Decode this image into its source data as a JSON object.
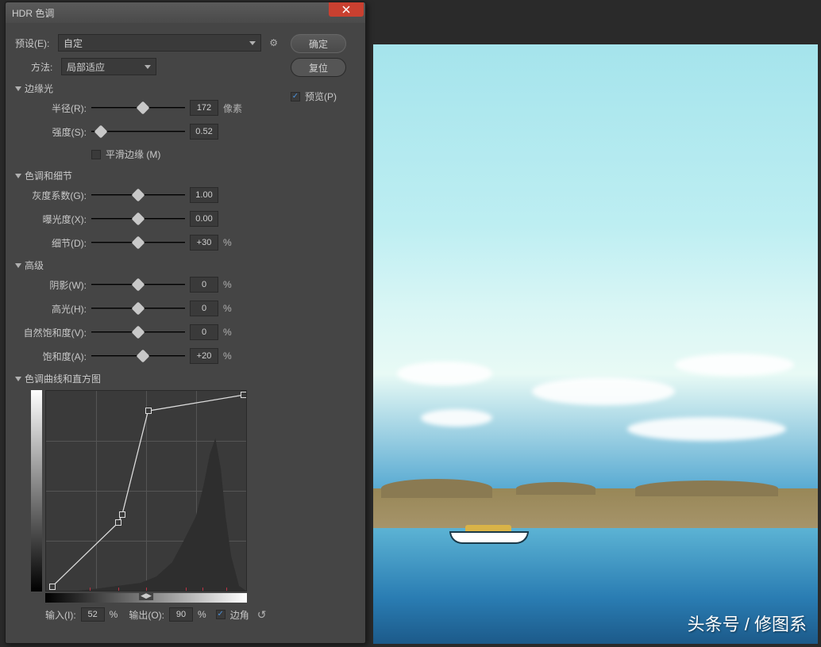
{
  "dialog": {
    "title": "HDR 色调",
    "preset_label": "预设(E):",
    "preset_value": "自定",
    "method_label": "方法:",
    "method_value": "局部适应"
  },
  "buttons": {
    "ok": "确定",
    "reset": "复位"
  },
  "preview": {
    "label": "预览(P)",
    "checked": true
  },
  "sections": {
    "edge": "边缘光",
    "tone": "色调和细节",
    "advanced": "高级",
    "curve": "色调曲线和直方图"
  },
  "sliders": {
    "radius": {
      "label": "半径(R):",
      "value": "172",
      "unit": "像素",
      "pos": 55
    },
    "strength": {
      "label": "强度(S):",
      "value": "0.52",
      "unit": "",
      "pos": 10
    },
    "smooth": {
      "label": "平滑边缘 (M)",
      "checked": false
    },
    "gamma": {
      "label": "灰度系数(G):",
      "value": "1.00",
      "unit": "",
      "pos": 50
    },
    "exposure": {
      "label": "曝光度(X):",
      "value": "0.00",
      "unit": "",
      "pos": 50
    },
    "detail": {
      "label": "细节(D):",
      "value": "+30",
      "unit": "%",
      "pos": 50
    },
    "shadow": {
      "label": "阴影(W):",
      "value": "0",
      "unit": "%",
      "pos": 50
    },
    "highlight": {
      "label": "高光(H):",
      "value": "0",
      "unit": "%",
      "pos": 50
    },
    "vibrance": {
      "label": "自然饱和度(V):",
      "value": "0",
      "unit": "%",
      "pos": 50
    },
    "saturation": {
      "label": "饱和度(A):",
      "value": "+20",
      "unit": "%",
      "pos": 55
    }
  },
  "curve": {
    "input_label": "输入(I):",
    "input_value": "52",
    "input_unit": "%",
    "output_label": "输出(O):",
    "output_value": "90",
    "output_unit": "%",
    "corner_label": "边角",
    "points": [
      {
        "x": 3,
        "y": 98
      },
      {
        "x": 36,
        "y": 66
      },
      {
        "x": 38,
        "y": 62
      },
      {
        "x": 51,
        "y": 10
      },
      {
        "x": 99,
        "y": 2
      }
    ]
  },
  "watermark": "头条号 / 修图系"
}
